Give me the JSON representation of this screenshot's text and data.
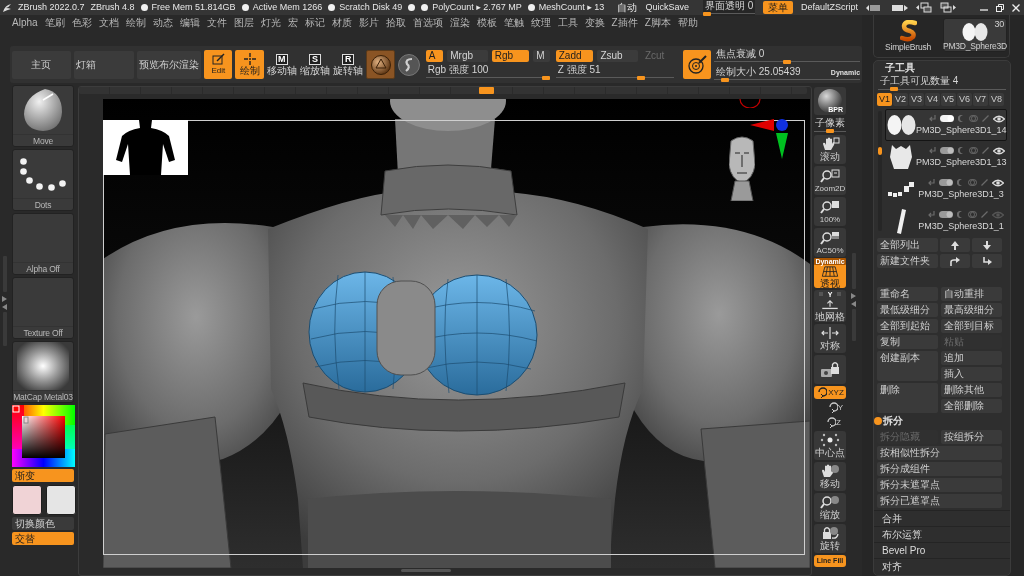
{
  "title_bar": {
    "app_title": "ZBrush 2022.0.7",
    "version": "ZBrush 4.8",
    "stats": [
      {
        "kind": "stat",
        "text": "Free Mem 51.814GB"
      },
      {
        "kind": "stat",
        "text": "Active Mem 1266"
      },
      {
        "kind": "stat",
        "text": "Scratch Disk 49"
      },
      {
        "kind": "dot"
      },
      {
        "kind": "stat",
        "text": "PolyCount ▸ 2.767 MP"
      },
      {
        "kind": "stat",
        "text": "MeshCount ▸ 13"
      }
    ],
    "autosave": "自动",
    "quicksave": "QuickSave",
    "transparency": {
      "label": "界面透明 0",
      "level": 0
    },
    "menu_button": "菜单",
    "script": "DefaultZScript"
  },
  "menu_bar": [
    "Alpha",
    "笔刷",
    "色彩",
    "文档",
    "绘制",
    "动态",
    "编辑",
    "文件",
    "图层",
    "灯光",
    "宏",
    "标记",
    "材质",
    "影片",
    "拾取",
    "首选项",
    "渲染",
    "模板",
    "笔触",
    "纹理",
    "工具",
    "变换",
    "Z插件",
    "Z脚本",
    "帮助"
  ],
  "toolbar": {
    "nav_buttons": [
      "主页",
      "灯箱",
      "预览布尔渲染"
    ],
    "modes": [
      {
        "kind": "edit",
        "label": "Edit",
        "selected": true
      },
      {
        "kind": "draw",
        "label": "绘制",
        "selected": true
      },
      {
        "kind": "gizmo",
        "key": "M",
        "label": "移动轴",
        "selected": false
      },
      {
        "kind": "gizmo",
        "key": "S",
        "label": "缩放轴",
        "selected": false
      },
      {
        "kind": "gizmo",
        "key": "R",
        "label": "旋转轴",
        "selected": false
      }
    ],
    "channels": [
      {
        "label": "A",
        "selected": true
      },
      {
        "label": "Mrgb",
        "selected": false
      },
      {
        "label": "Rgb",
        "selected": true
      },
      {
        "label": "M",
        "selected": false
      }
    ],
    "rgb_intensity": {
      "label": "Rgb 强度 100",
      "level": 1
    },
    "sculpt_modes": [
      {
        "label": "Zadd",
        "selected": true,
        "disabled": false
      },
      {
        "label": "Zsub",
        "selected": false,
        "disabled": false
      },
      {
        "label": "Zcut",
        "selected": false,
        "disabled": true
      }
    ],
    "z_intensity": {
      "label": "Z 强度 51",
      "level": 0.74
    },
    "focal_shift": {
      "label": "焦点衰减 0",
      "level": 0.5
    },
    "draw_size": {
      "label": "绘制大小 25.05439",
      "level": 0.05
    },
    "dynamic_badge": "Dynamic"
  },
  "left_panel": {
    "thumbnails": [
      {
        "kind": "brush",
        "label": "Move"
      },
      {
        "kind": "stroke",
        "label": "Dots"
      },
      {
        "kind": "blank",
        "label": "Alpha Off"
      },
      {
        "kind": "blank",
        "label": "Texture Off"
      },
      {
        "kind": "material",
        "label": "MatCap Metal03"
      }
    ],
    "gradient": {
      "label": "渐变",
      "on": true
    },
    "swatches": [
      {
        "color": "#f0d3d6"
      },
      {
        "color": "#e5e5e5"
      }
    ],
    "switch_color": {
      "label": "切换颜色"
    },
    "alternate": {
      "label": "交替",
      "on": true
    }
  },
  "right_toolbar": [
    {
      "kind": "bpr",
      "label": "BPR",
      "selected": false
    },
    {
      "kind": "slider",
      "label": "子像素",
      "level": 0.5
    },
    {
      "kind": "scroll",
      "label": "滚动",
      "selected": false
    },
    {
      "kind": "zoom",
      "label": "Zoom2D",
      "selected": false
    },
    {
      "kind": "actual",
      "label": "100%",
      "selected": false
    },
    {
      "kind": "half",
      "label": "AC50%",
      "selected": false
    },
    {
      "kind": "perspective",
      "label": "透视",
      "badge": "Dynamic",
      "selected": true
    },
    {
      "kind": "floor",
      "label": "地网格",
      "badge": "Y",
      "selected": false
    },
    {
      "kind": "symmetry",
      "label": "对称",
      "selected": false
    },
    {
      "kind": "lock",
      "selected": false
    },
    {
      "kind": "axis",
      "label": "XYZ",
      "selected": true
    },
    {
      "kind": "rotate",
      "label": "Y",
      "selected": false
    },
    {
      "kind": "rotate",
      "label": "Z",
      "selected": false
    },
    {
      "kind": "center",
      "label": "中心点",
      "selected": false
    },
    {
      "kind": "move",
      "label": "移动",
      "selected": false
    },
    {
      "kind": "scale",
      "label": "缩放",
      "selected": false
    },
    {
      "kind": "turn",
      "label": "旋转",
      "selected": false
    },
    {
      "kind": "linefill",
      "label": "Line Fill",
      "selected": true
    }
  ],
  "tool_panel": {
    "tools": [
      {
        "kind": "brush",
        "label": "SimpleBrush"
      },
      {
        "kind": "mesh",
        "label": "PM3D_Sphere3D",
        "count": "30"
      }
    ]
  },
  "subtool": {
    "title": "子工具",
    "visible_count": {
      "label": "子工具可见数量 4",
      "level": 0.1
    },
    "versions": [
      {
        "label": "V1",
        "selected": true
      },
      {
        "label": "V2",
        "selected": false
      },
      {
        "label": "V3",
        "selected": false
      },
      {
        "label": "V4",
        "selected": false
      },
      {
        "label": "V5",
        "selected": false
      },
      {
        "label": "V6",
        "selected": false
      },
      {
        "label": "V7",
        "selected": false
      },
      {
        "label": "V8",
        "selected": false
      }
    ],
    "items": [
      {
        "kind": "pair",
        "name": "PM3D_Sphere3D1_14",
        "selected": true,
        "visible": true
      },
      {
        "kind": "vest",
        "name": "PM3D_Sphere3D1_13",
        "selected": false,
        "visible": true
      },
      {
        "kind": "chain",
        "name": "PM3D_Sphere3D1_3",
        "selected": false,
        "visible": true
      },
      {
        "kind": "bar",
        "name": "PM3D_Sphere3D1_1",
        "selected": false,
        "visible": false
      }
    ],
    "list_buttons": [
      {
        "kind": "label",
        "label": "全部列出"
      },
      {
        "kind": "up"
      },
      {
        "kind": "down"
      },
      {
        "kind": "label",
        "label": "新建文件夹"
      },
      {
        "kind": "bend"
      },
      {
        "kind": "drop"
      }
    ],
    "actions": [
      {
        "label": "重命名",
        "kind": "normal",
        "disabled": false
      },
      {
        "label": "自动重排",
        "kind": "normal",
        "disabled": false
      },
      {
        "label": "最低级细分",
        "kind": "normal",
        "disabled": false
      },
      {
        "label": "最高级细分",
        "kind": "normal",
        "disabled": false
      },
      {
        "label": "全部到起始",
        "kind": "normal",
        "disabled": false
      },
      {
        "label": "全部到目标",
        "kind": "normal",
        "disabled": false
      },
      {
        "label": "复制",
        "kind": "normal",
        "disabled": false
      },
      {
        "label": "粘贴",
        "kind": "normal",
        "disabled": true
      },
      {
        "label": "创建副本",
        "kind": "tall",
        "disabled": false
      },
      {
        "label": "追加",
        "kind": "normal",
        "disabled": false
      },
      {
        "label": "插入",
        "kind": "normal",
        "disabled": false
      },
      {
        "label": "删除",
        "kind": "tall",
        "disabled": false
      },
      {
        "label": "删除其他",
        "kind": "normal",
        "disabled": false
      },
      {
        "label": "全部删除",
        "kind": "normal",
        "disabled": false
      }
    ]
  },
  "split": {
    "title": "拆分",
    "buttons": [
      {
        "label": "拆分隐藏",
        "kind": "half",
        "disabled": true
      },
      {
        "label": "按组拆分",
        "kind": "half",
        "disabled": false
      },
      {
        "label": "按相似性拆分",
        "kind": "full",
        "disabled": false
      },
      {
        "label": "拆分成组件",
        "kind": "full",
        "disabled": false
      },
      {
        "label": "拆分未遮罩点",
        "kind": "full",
        "disabled": false
      },
      {
        "label": "拆分已遮罩点",
        "kind": "full",
        "disabled": false
      }
    ]
  },
  "sections": [
    "合并",
    "布尔运算",
    "Bevel Pro",
    "对齐"
  ]
}
